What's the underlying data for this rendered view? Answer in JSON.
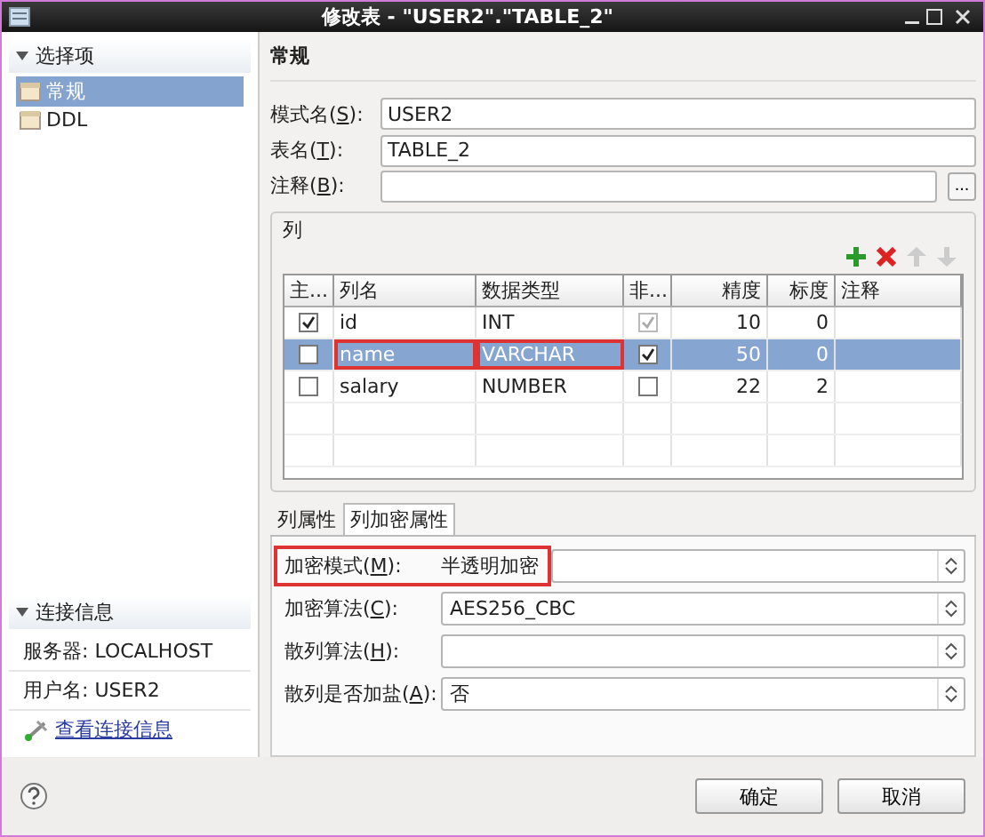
{
  "window": {
    "title": "修改表 - \"USER2\".\"TABLE_2\""
  },
  "sidebar": {
    "section": "选择项",
    "items": [
      {
        "label": "常规",
        "selected": true
      },
      {
        "label": "DDL",
        "selected": false
      }
    ],
    "connection": {
      "title": "连接信息",
      "server": "服务器: LOCALHOST",
      "user": "用户名: USER2",
      "link": "查看连接信息"
    }
  },
  "page": {
    "title": "常规",
    "fields": [
      {
        "label_start": "模式名(",
        "mnemonic": "S",
        "label_end": "):",
        "value": "USER2"
      },
      {
        "label_start": "表名(",
        "mnemonic": "T",
        "label_end": "):",
        "value": "TABLE_2"
      },
      {
        "label_start": "注释(",
        "mnemonic": "B",
        "label_end": "):",
        "browse_label": "..."
      }
    ],
    "columns_group": {
      "title": "列",
      "toolbar": [
        {
          "kind": "add",
          "disabled": false
        },
        {
          "kind": "delete",
          "disabled": false
        },
        {
          "kind": "up",
          "disabled": true
        },
        {
          "kind": "down",
          "disabled": true
        }
      ],
      "table": {
        "columns": [
          "主...",
          "列名",
          "数据类型",
          "非...",
          "精度",
          "标度",
          "注释"
        ],
        "rows": [
          {
            "primary_key": true,
            "name": "id",
            "type": "INT",
            "not_null": true,
            "not_null_disabled": true,
            "precision": "10",
            "scale": "0",
            "selected": false,
            "highlighted": false
          },
          {
            "primary_key": false,
            "name": "name",
            "type": "VARCHAR",
            "not_null": true,
            "not_null_disabled": false,
            "precision": "50",
            "scale": "0",
            "selected": true,
            "highlighted": true
          },
          {
            "primary_key": false,
            "name": "salary",
            "type": "NUMBER",
            "not_null": false,
            "not_null_disabled": false,
            "precision": "22",
            "scale": "2",
            "selected": false,
            "highlighted": false
          }
        ]
      }
    },
    "tabs": [
      {
        "label": "列属性",
        "selected": false
      },
      {
        "label": "列加密属性",
        "selected": true
      }
    ],
    "encryption": [
      {
        "label_start": "加密模式(",
        "mnemonic": "M",
        "label_end": "):",
        "value": "半透明加密",
        "highlighted": true
      },
      {
        "label_start": "加密算法(",
        "mnemonic": "C",
        "label_end": "):",
        "value": "AES256_CBC",
        "highlighted": false
      },
      {
        "label_start": "散列算法(",
        "mnemonic": "H",
        "label_end": "):",
        "highlighted": false
      },
      {
        "label_start": "散列是否加盐(",
        "mnemonic": "A",
        "label_end": "):",
        "value": "否",
        "highlighted": false
      }
    ]
  },
  "buttons": [
    {
      "label": "确定"
    },
    {
      "label": "取消"
    }
  ]
}
